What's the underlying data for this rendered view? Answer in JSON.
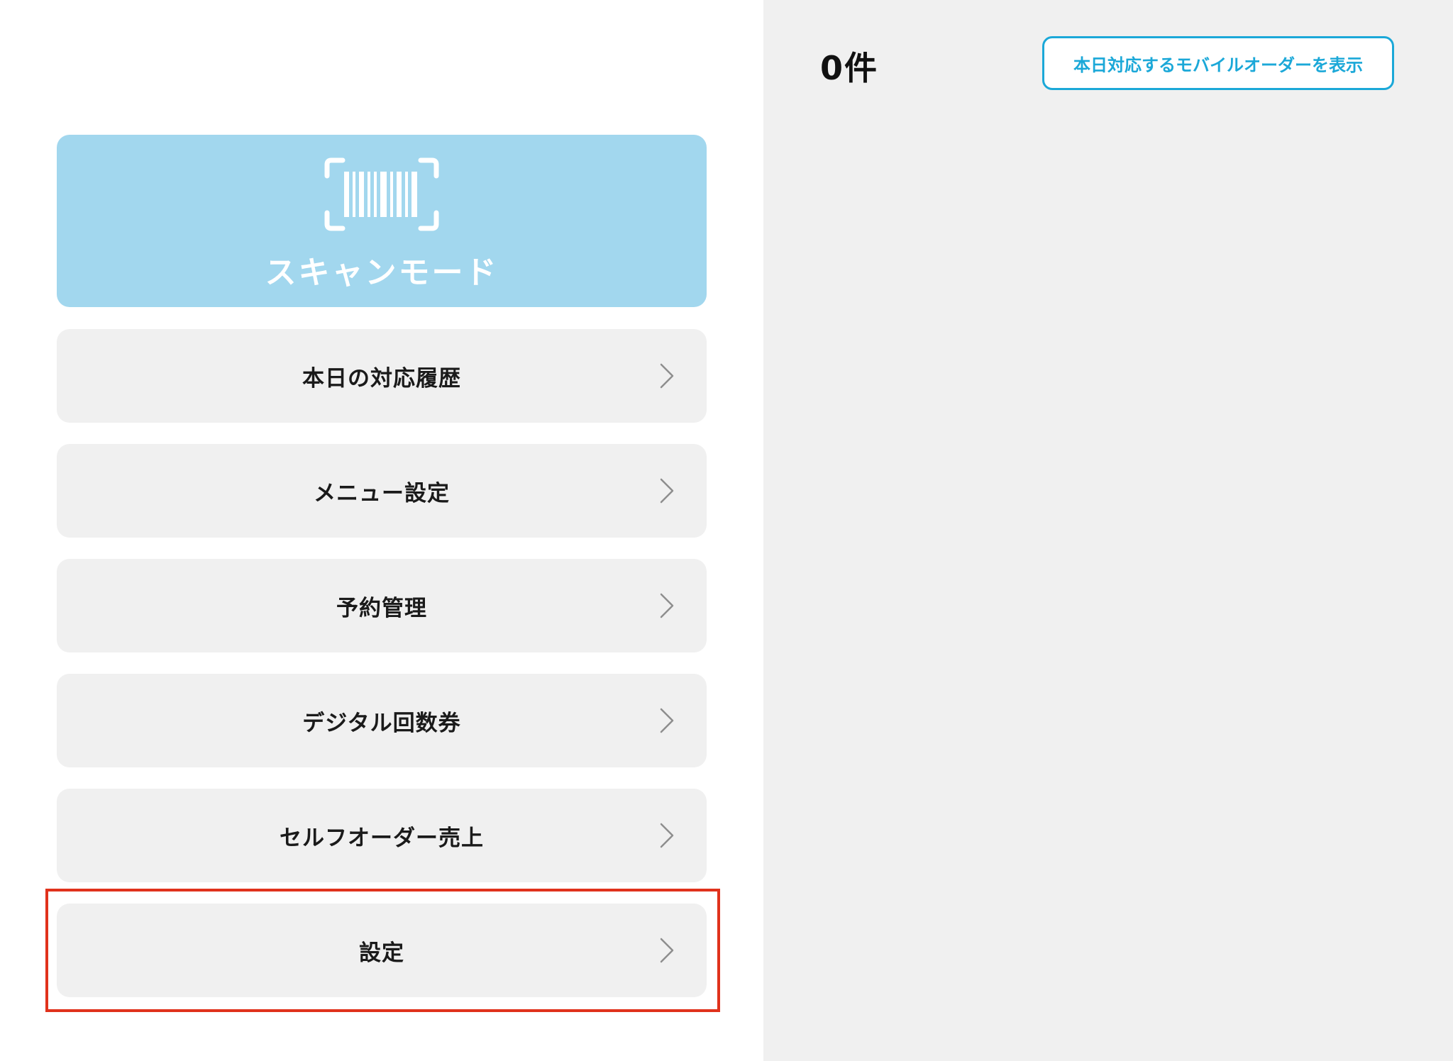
{
  "header": {
    "order_count": "0件",
    "mobile_order_button_label": "本日対応するモバイルオーダーを表示"
  },
  "scan": {
    "label": "スキャンモード",
    "icon": "barcode-scan-icon"
  },
  "menu": {
    "items": [
      {
        "label": "本日の対応履歴",
        "icon": "chevron-right-icon"
      },
      {
        "label": "メニュー設定",
        "icon": "chevron-right-icon"
      },
      {
        "label": "予約管理",
        "icon": "chevron-right-icon"
      },
      {
        "label": "デジタル回数券",
        "icon": "chevron-right-icon"
      },
      {
        "label": "セルフオーダー売上",
        "icon": "chevron-right-icon"
      },
      {
        "label": "設定",
        "icon": "chevron-right-icon"
      }
    ]
  },
  "colors": {
    "accent": "#1ba8d8",
    "scan_background": "#a2d7ee",
    "menu_background": "#f0f0f0",
    "highlight": "#e0321c"
  }
}
